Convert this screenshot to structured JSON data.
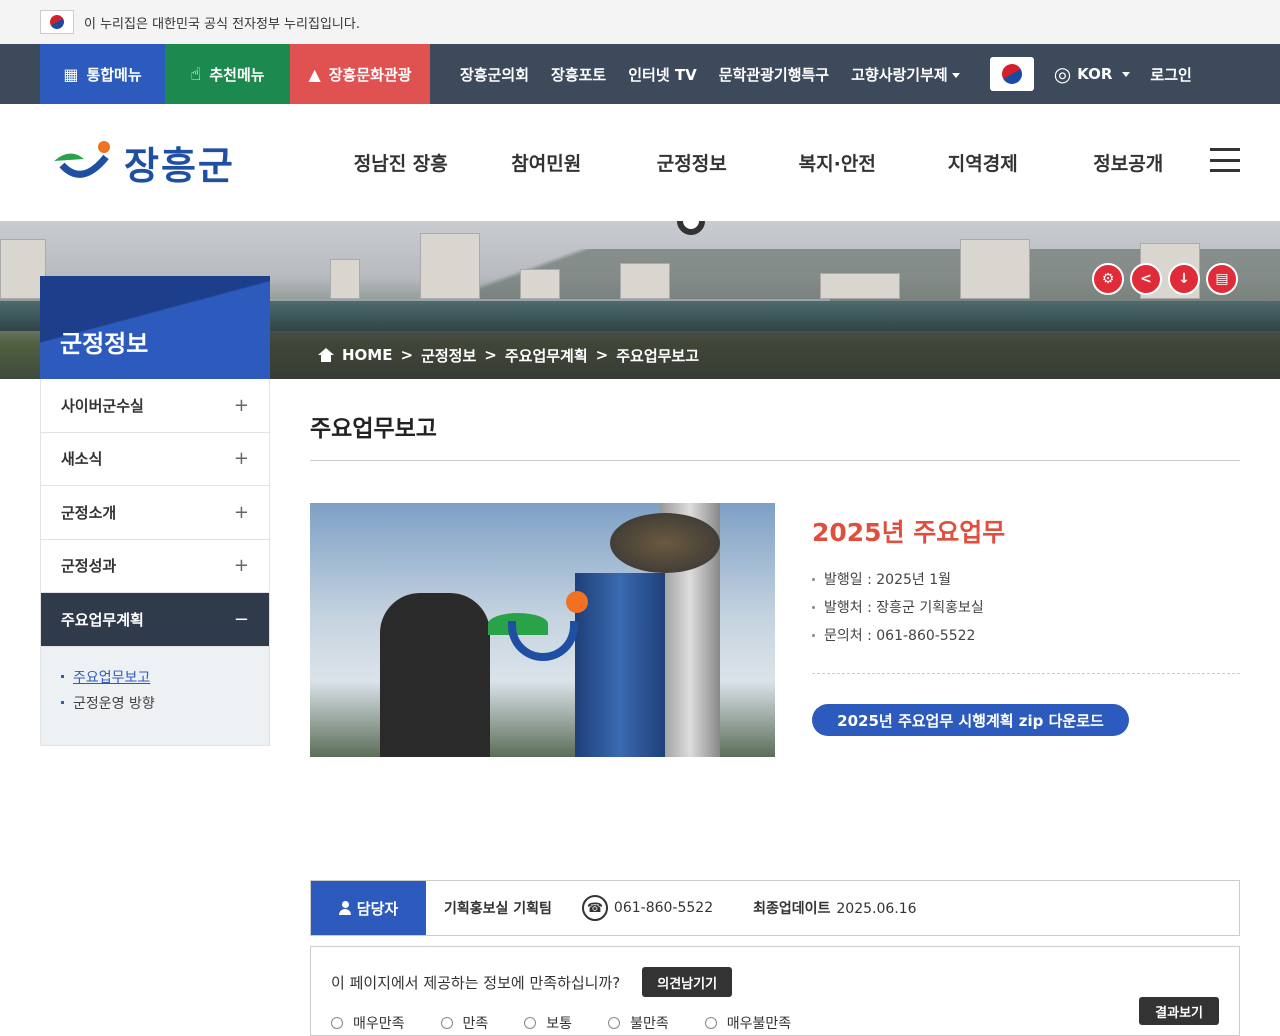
{
  "gov_banner": {
    "text": "이 누리집은 대한민국 공식 전자정부 누리집입니다."
  },
  "top_bar": {
    "quick": [
      "통합메뉴",
      "추천메뉴",
      "장흥문화관광"
    ],
    "links": [
      "장흥군의회",
      "장흥포토",
      "인터넷 TV",
      "문학관광기행특구",
      "고향사랑기부제"
    ],
    "language": "KOR",
    "login": "로그인"
  },
  "header": {
    "logo_text": "장흥군",
    "gnb": [
      "정남진 장흥",
      "참여민원",
      "군정정보",
      "복지·안전",
      "지역경제",
      "정보공개"
    ]
  },
  "visual": {
    "section_title": "군정정보",
    "breadcrumb": [
      "HOME",
      ">",
      "군정정보",
      ">",
      "주요업무계획",
      ">",
      "주요업무보고"
    ]
  },
  "lnb": {
    "items": [
      "사이버군수실",
      "새소식",
      "군정소개",
      "군정성과",
      "주요업무계획"
    ],
    "active_sub": [
      "주요업무보고",
      "군정운영 방향"
    ]
  },
  "content": {
    "page_title": "주요업무보고",
    "feature_title": "2025년 주요업무",
    "info": [
      "발행일 : 2025년 1월",
      "발행처 : 장흥군 기획홍보실",
      "문의처 : 061-860-5522"
    ],
    "download_label": "2025년 주요업무 시행계획 zip 다운로드"
  },
  "manager": {
    "label": "담당자",
    "dept": "기획홍보실 기획팀",
    "phone": "061-860-5522",
    "update_label": "최종업데이트",
    "update_date": "2025.06.16"
  },
  "survey": {
    "question": "이 페이지에서 제공하는 정보에 만족하십니까?",
    "opinion_button": "의견남기기",
    "options": [
      "매우만족",
      "만족",
      "보통",
      "불만족",
      "매우불만족"
    ],
    "result_button": "결과보기"
  }
}
